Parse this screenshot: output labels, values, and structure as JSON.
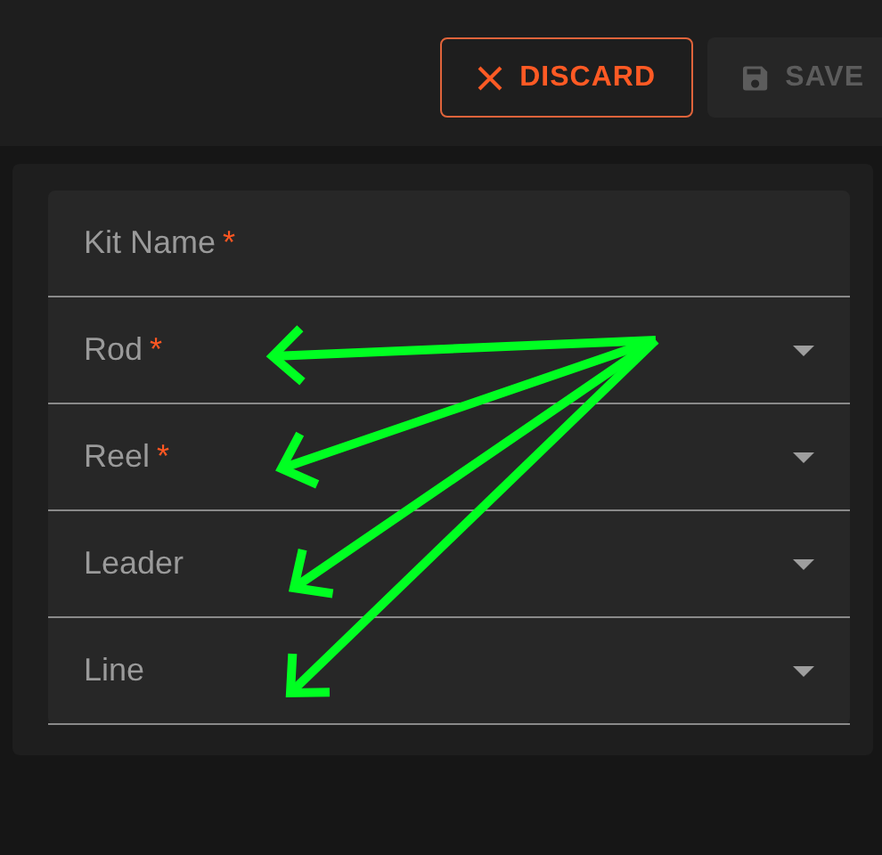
{
  "toolbar": {
    "buttons": [
      {
        "label": "DISCARD",
        "kind": "discard",
        "disabled": false
      },
      {
        "label": "SAVE",
        "kind": "save",
        "disabled": true
      }
    ]
  },
  "form": {
    "fields": [
      {
        "label": "Kit Name",
        "required_mark": "*",
        "kind": "text"
      },
      {
        "label": "Rod",
        "required_mark": "*",
        "kind": "select"
      },
      {
        "label": "Reel",
        "required_mark": "*",
        "kind": "select"
      },
      {
        "label": "Leader",
        "kind": "select"
      },
      {
        "label": "Line",
        "kind": "select"
      }
    ]
  }
}
